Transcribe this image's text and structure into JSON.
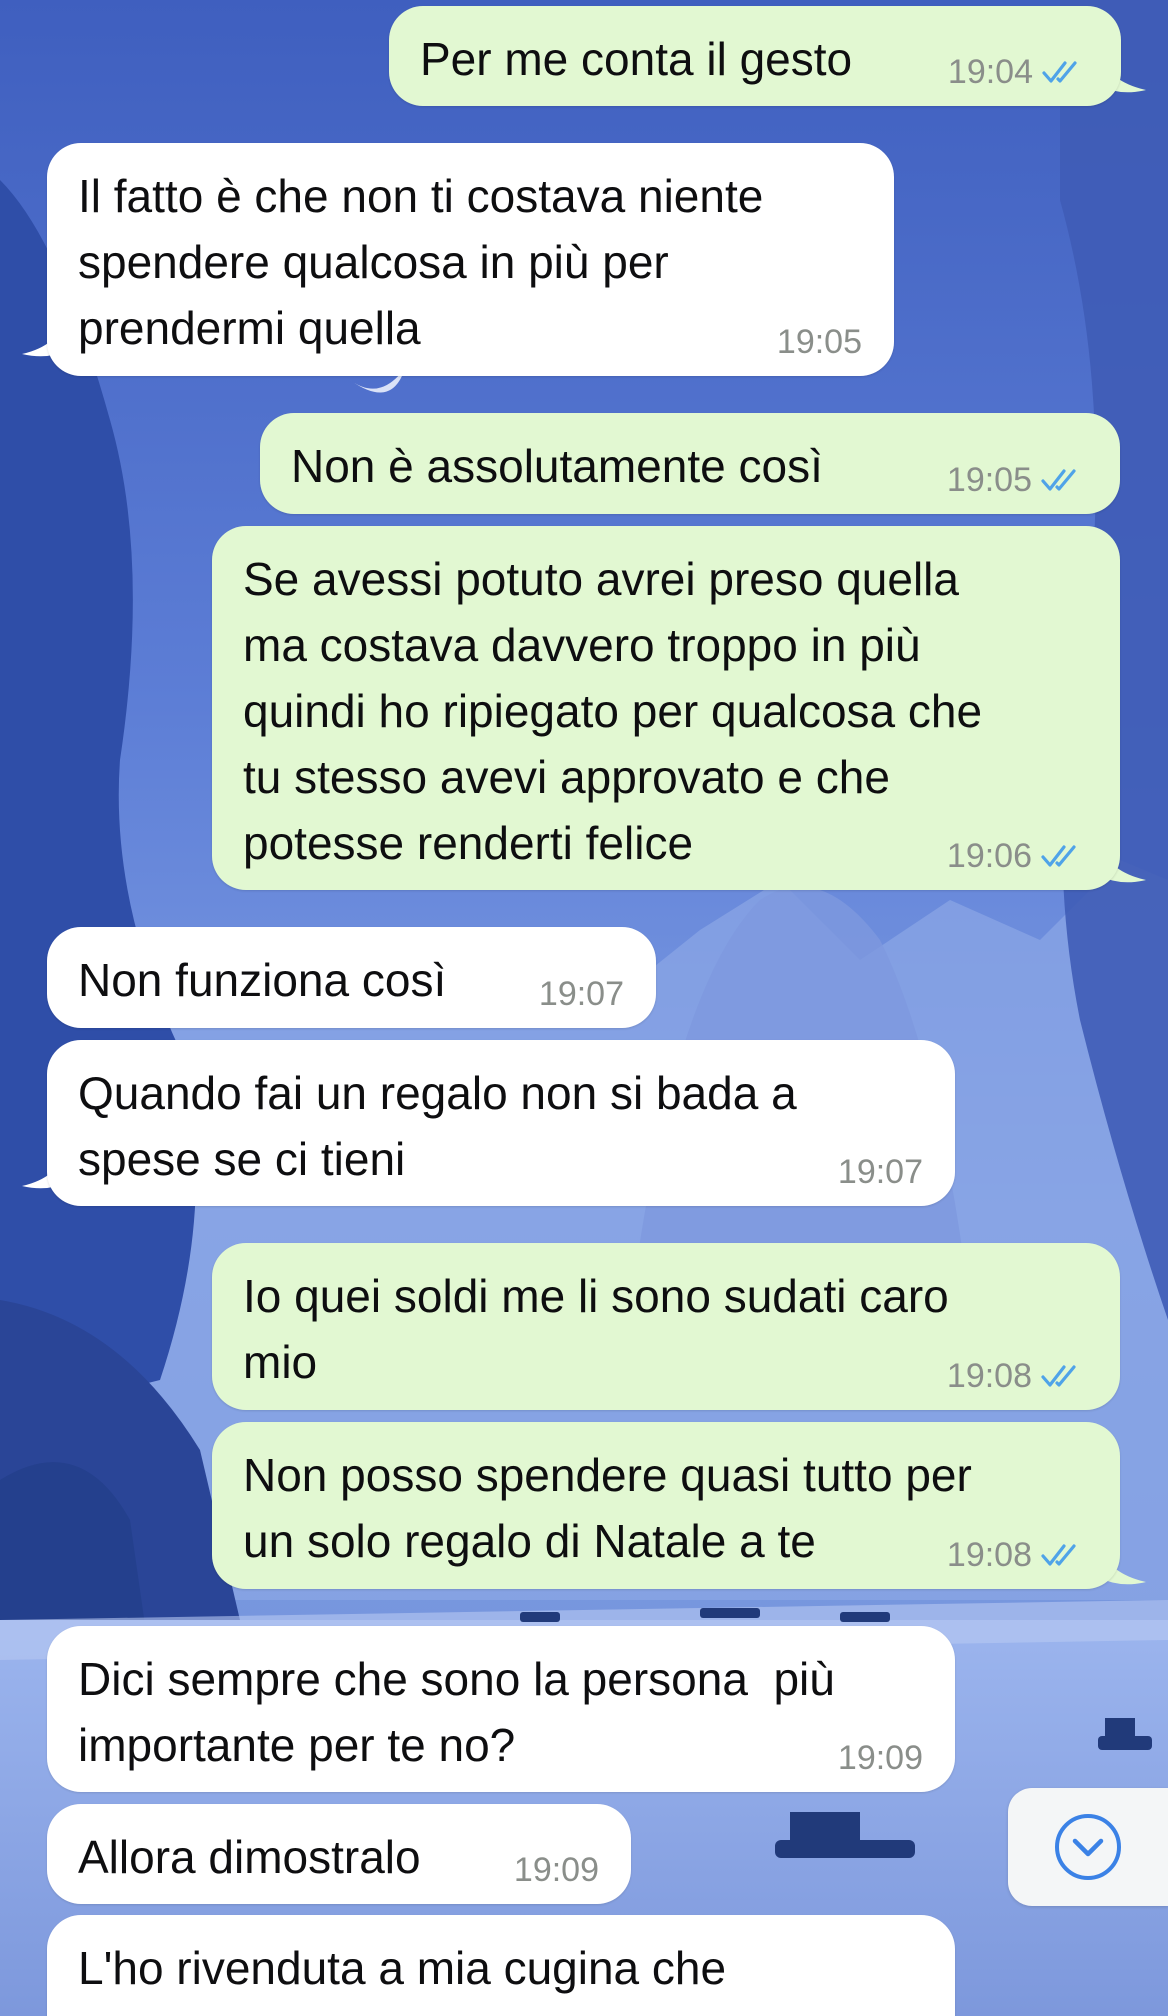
{
  "chat": {
    "messages": [
      {
        "side": "out",
        "text": "Per me conta il gesto",
        "time": "19:04",
        "status": "read"
      },
      {
        "side": "in",
        "text": "Il fatto è che non ti costava niente\nspendere qualcosa in più per\nprendermi quella",
        "time": "19:05"
      },
      {
        "side": "out",
        "text": "Non è assolutamente così",
        "time": "19:05",
        "status": "read"
      },
      {
        "side": "out",
        "text": "Se avessi potuto avrei preso quella\nma costava davvero troppo in più\nquindi ho ripiegato per qualcosa che\ntu stesso avevi approvato e che\npotesse renderti felice",
        "time": "19:06",
        "status": "read"
      },
      {
        "side": "in",
        "text": "Non funziona così",
        "time": "19:07"
      },
      {
        "side": "in",
        "text": "Quando fai un regalo non si bada a\nspese se ci tieni",
        "time": "19:07"
      },
      {
        "side": "out",
        "text": "Io quei soldi me li sono sudati caro\nmio",
        "time": "19:08",
        "status": "read"
      },
      {
        "side": "out",
        "text": "Non posso spendere quasi tutto per\nun solo regalo di Natale a te",
        "time": "19:08",
        "status": "read"
      },
      {
        "side": "in",
        "text": "Dici sempre che sono la persona  più\nimportante per te no?",
        "time": "19:09"
      },
      {
        "side": "in",
        "text": "Allora dimostralo",
        "time": "19:09"
      },
      {
        "side": "in",
        "text": "L'ho rivenduta a mia cugina che\nche",
        "time": ""
      }
    ]
  },
  "controls": {
    "scroll_down_icon": "chevron-down-circle-icon"
  },
  "colors": {
    "incoming_bubble": "#ffffff",
    "outgoing_bubble": "#e2f8d2",
    "read_ticks": "#4fa3e8",
    "timestamp": "#8a8e8a",
    "scroll_icon": "#3b82e6"
  }
}
